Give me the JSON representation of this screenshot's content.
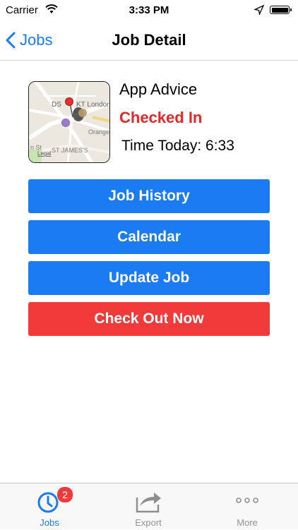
{
  "status_bar": {
    "carrier": "Carrier",
    "time": "3:33 PM"
  },
  "nav": {
    "back_label": "Jobs",
    "title": "Job Detail"
  },
  "job": {
    "name": "App Advice",
    "status": "Checked In",
    "time_today": "Time Today: 6:33",
    "map_labels": {
      "district_a": "DS",
      "district_b": "KT London",
      "street_a": "Orange",
      "street_b": "ST JAMES'S",
      "street_c": "n St",
      "legal": "Legal"
    }
  },
  "actions": {
    "job_history": "Job History",
    "calendar": "Calendar",
    "update_job": "Update Job",
    "check_out": "Check Out Now"
  },
  "tabs": [
    {
      "label": "Jobs",
      "badge": "2"
    },
    {
      "label": "Export"
    },
    {
      "label": "More"
    }
  ],
  "colors": {
    "accent": "#1a7bf2",
    "danger": "#f23a3a",
    "status_red": "#e12a2a"
  }
}
